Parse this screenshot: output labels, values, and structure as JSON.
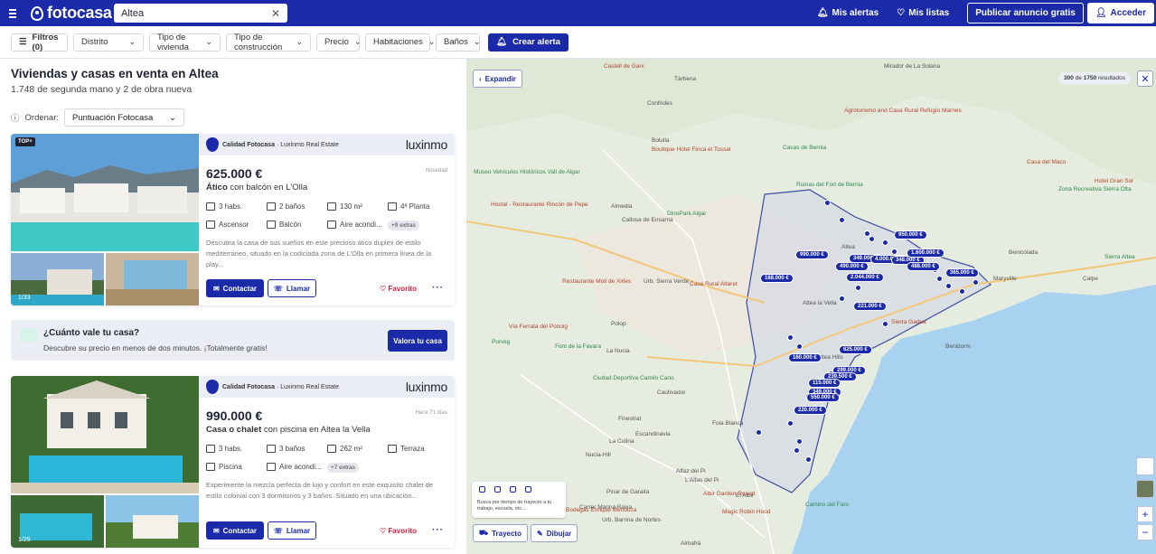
{
  "header": {
    "logo": "fotocasa",
    "search_value": "Altea",
    "nav": {
      "alerts": "Mis alertas",
      "lists": "Mis listas",
      "publish": "Publicar anuncio gratis",
      "login": "Acceder"
    }
  },
  "filters": {
    "filters_btn": "Filtros (0)",
    "items": [
      "Distrito",
      "Tipo de vivienda",
      "Tipo de construcción",
      "Precio",
      "Habitaciones",
      "Baños"
    ],
    "alert_btn": "Crear alerta"
  },
  "results": {
    "title": "Viviendas y casas en venta en Altea",
    "subtitle": "1.748 de segunda mano y 2 de obra nueva",
    "sort_label": "Ordenar:",
    "sort_value": "Puntuación Fotocasa"
  },
  "listings": [
    {
      "badge": "TOP+",
      "photos": "1/33",
      "agency_label": "Calidad Fotocasa",
      "agency_name": "· Luxinmo Real Estate",
      "brand": "luxinmo",
      "age": "Novedad",
      "price": "625.000 €",
      "type": "Ático",
      "title_rest": " con balcón en L'Olla",
      "features": [
        "3 habs.",
        "2 baños",
        "130 m²",
        "4ª Planta",
        "Ascensor",
        "Balcón",
        "Aire acondi..."
      ],
      "extras": "+9 extras",
      "description": "Descubra la casa de sus sueños en este precioso ático duplex de estilo mediterráneo, situado en la codiciada zona de L'Olla en primera línea de la play...",
      "contact": "Contactar",
      "call": "Llamar",
      "favorite": "Favorito"
    },
    {
      "badge": "",
      "photos": "1/29",
      "agency_label": "Calidad Fotocasa",
      "agency_name": "· Luxinmo Real Estate",
      "brand": "luxinmo",
      "age": "Hace 71 días",
      "price": "990.000 €",
      "type": "Casa o chalet",
      "title_rest": " con piscina en Altea la Vella",
      "features": [
        "3 habs.",
        "3 baños",
        "262 m²",
        "Terraza",
        "Piscina",
        "Aire acondi..."
      ],
      "extras": "+7 extras",
      "description": "Experimente la mezcla perfecta de lujo y confort en este exquisito chalet de estilo colonial con 3 dormitorios y 3 baños. Situado en una ubicación...",
      "contact": "Contactar",
      "call": "Llamar",
      "favorite": "Favorito"
    }
  ],
  "banner": {
    "title": "¿Cuánto vale tu casa?",
    "subtitle": "Descubre su precio en menos de dos minutos. ¡Totalmente gratis!",
    "button": "Valora tu casa"
  },
  "map": {
    "expand": "Expandir",
    "results_count": "300",
    "results_total": "1750",
    "results_of": "de",
    "results_suffix": "resultados",
    "route_hint": "Busca por tiempo de trayecto a tu trabajo, escuela, etc...",
    "route_btn": "Trayecto",
    "draw_btn": "Dibujar",
    "price_pins": [
      "950.000 €",
      "990.000 €",
      "349.000 €",
      "4.000.000 €",
      "348.000 €",
      "1.600.000 €",
      "490.000 €",
      "488.000 €",
      "168.000 €",
      "2.044.000 €",
      "365.000 €",
      "221.000 €",
      "625.000 €",
      "160.000 €",
      "299.000 €",
      "239.500 €",
      "115.000 €",
      "349.000 €",
      "550.000 €",
      "220.000 €"
    ],
    "places": [
      "Tàrbena",
      "Bolulla",
      "Callosa de Ensarrià",
      "Polop",
      "La Nucia",
      "Benidorm",
      "Altea",
      "Calpe",
      "Benicolada",
      "Maryville",
      "Cautivador",
      "Foia Blanca",
      "Finestrat",
      "Altea la Vella",
      "La Colina",
      "Escandinavia",
      "El Albir",
      "Alfaz del Pi",
      "Urb. Sierra Verde",
      "Almedia",
      "L'Alfas del Pi",
      "Carrer Marina Baixa",
      "Nucia-Hill",
      "Pinar de Garaita",
      "Urb. Barrina de Nortes",
      "Almafrà",
      "Confrides",
      "Altea Hills"
    ],
    "pois": [
      "Castell de Garx",
      "Boutique Hotel Finca el Tossal",
      "Hostal - Restaurante Rincón de Pepe",
      "DinoPark Algar",
      "Casa Rural Altaret",
      "Restaurante Moli de Xirles",
      "Agroturismo and Casa Rural Refugio Marnes",
      "Casas de Bernia",
      "Ruinas del Fort de Bernia",
      "Zona Recreativa Sierra Olta",
      "Hotel Gran Sol",
      "Casa del Maco",
      "Mirador de La Solana",
      "Sierra Altea",
      "Magic Robin Hood",
      "Albir Garden Resort",
      "Camino del Faro",
      "Bodegas Enrique Mendoza",
      "Ciudad Deportiva Camilo Cano",
      "Vía Ferrata del Ponoig",
      "Ponoig",
      "Font de la Favara",
      "Museo Vehículos Históricos Vall de Algar",
      "Sierra Gadea"
    ]
  },
  "colors": {
    "brand": "#1b2aa8",
    "favorite": "#d8213f",
    "water": "#a9d2f1"
  }
}
